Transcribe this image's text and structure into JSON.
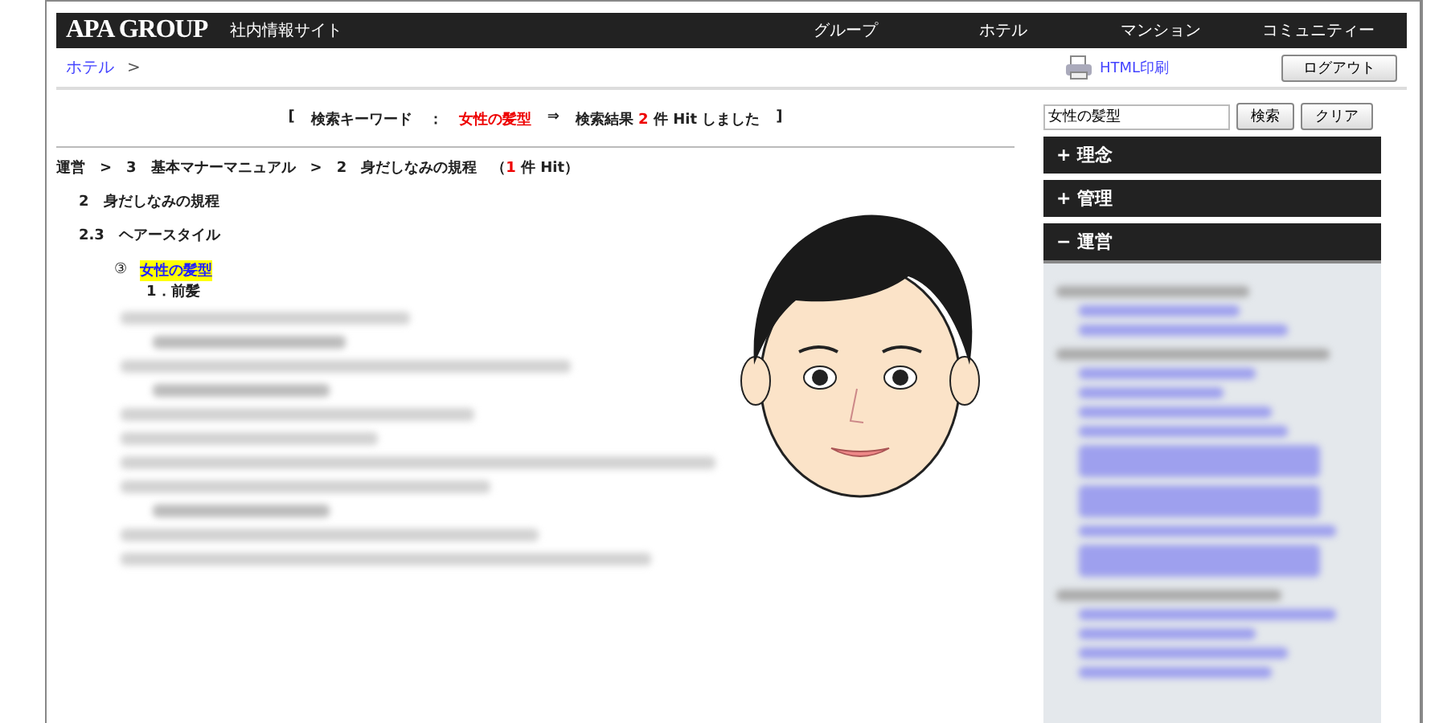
{
  "header": {
    "logo": "APA GROUP",
    "site_title": "社内情報サイト",
    "nav": [
      "グループ",
      "ホテル",
      "マンション",
      "コミュニティー"
    ]
  },
  "subbar": {
    "breadcrumb": "ホテル",
    "separator": ">",
    "print_link": "HTML印刷",
    "logout_button": "ログアウト"
  },
  "search_summary": {
    "open": "[",
    "label": "検索キーワード",
    "colon": "：",
    "keyword": "女性の髪型",
    "arrow": "⇒",
    "result_prefix": "検索結果",
    "count": "2",
    "result_suffix": "件 Hit しました",
    "close": "]"
  },
  "result_path": "運営　>　3　基本マナーマニュアル　>　2　身だしなみの規程　（**1** 件 Hit）",
  "section": "2　身だしなみの規程",
  "subsection": "2.3　ヘアースタイル",
  "hit": {
    "marker": "③",
    "title": "女性の髪型",
    "first_heading": "1．前髪"
  },
  "blurred_lines": [
    {
      "kind": "body"
    },
    {
      "kind": "heading"
    },
    {
      "kind": "body"
    },
    {
      "kind": "heading"
    },
    {
      "kind": "body"
    },
    {
      "kind": "body"
    },
    {
      "kind": "body"
    },
    {
      "kind": "body"
    },
    {
      "kind": "heading"
    },
    {
      "kind": "body"
    },
    {
      "kind": "body"
    }
  ],
  "sidebar": {
    "search_value": "女性の髪型",
    "search_button": "検索",
    "clear_button": "クリア",
    "categories": [
      {
        "label": "理念",
        "expanded": false,
        "marker": "+"
      },
      {
        "label": "管理",
        "expanded": false,
        "marker": "+"
      },
      {
        "label": "運営",
        "expanded": true,
        "marker": "−"
      }
    ],
    "blurred_entries": [
      {
        "kind": "group"
      },
      {
        "kind": "link"
      },
      {
        "kind": "link"
      },
      {
        "kind": "group"
      },
      {
        "kind": "link"
      },
      {
        "kind": "link"
      },
      {
        "kind": "link"
      },
      {
        "kind": "link"
      },
      {
        "kind": "link2"
      },
      {
        "kind": "link2"
      },
      {
        "kind": "link"
      },
      {
        "kind": "link2"
      },
      {
        "kind": "group"
      },
      {
        "kind": "link"
      },
      {
        "kind": "link"
      },
      {
        "kind": "link"
      },
      {
        "kind": "link"
      }
    ]
  }
}
